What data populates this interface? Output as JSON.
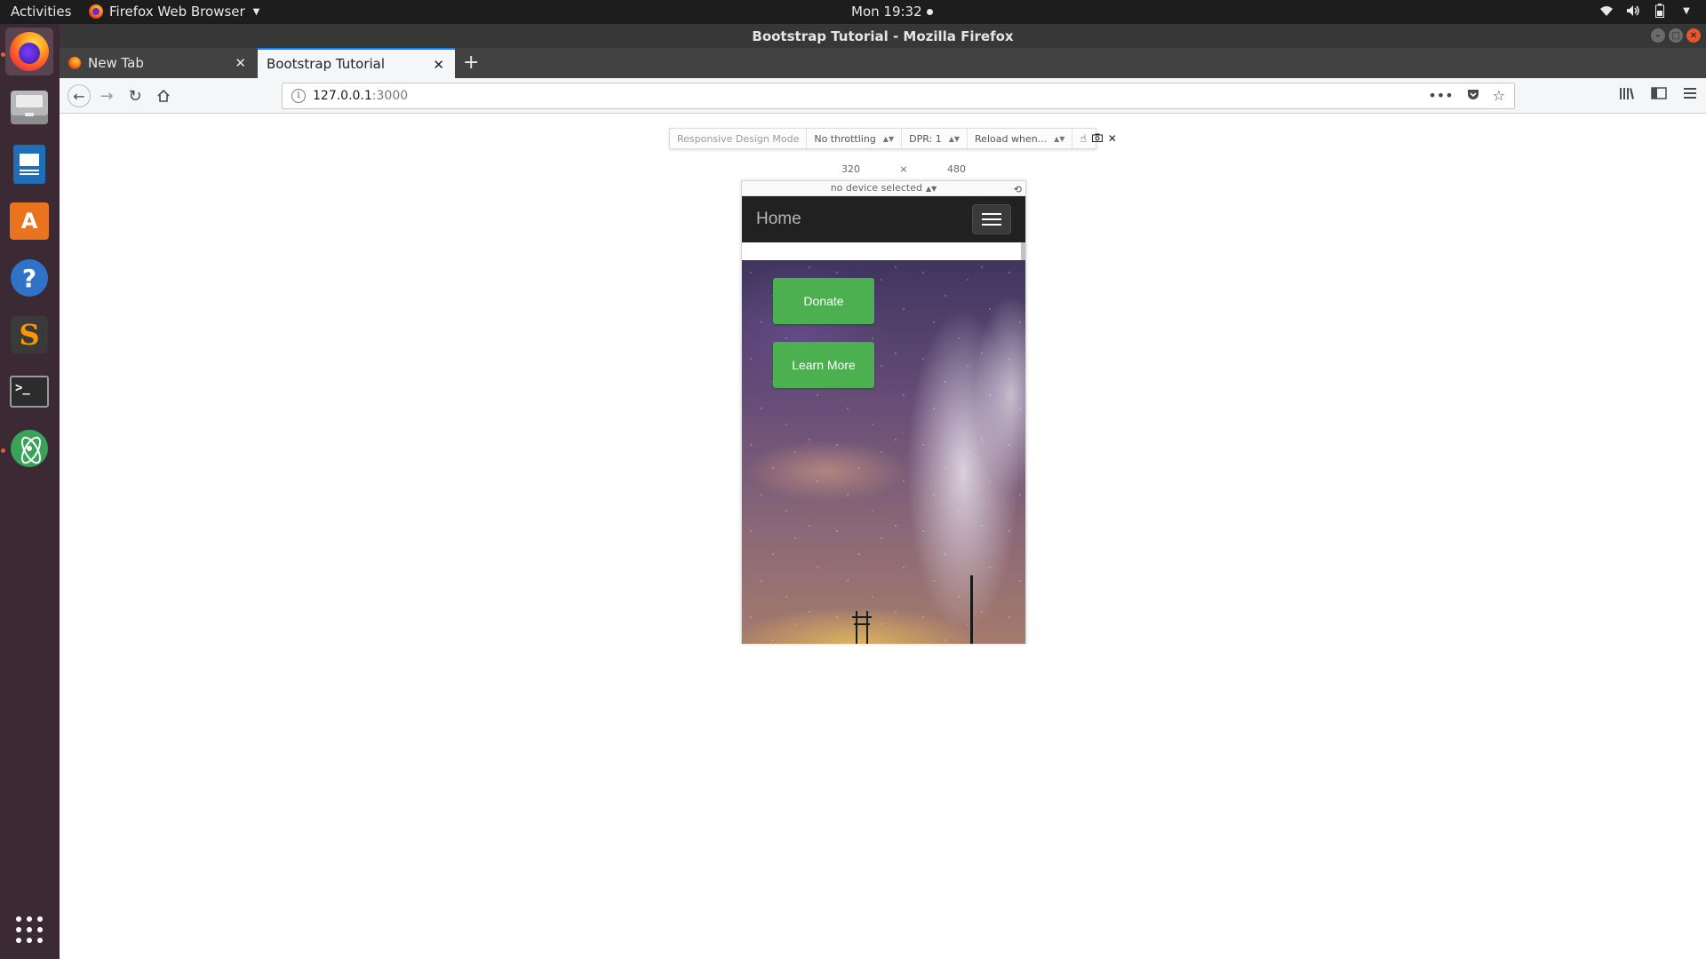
{
  "topbar": {
    "activities": "Activities",
    "app_name": "Firefox Web Browser",
    "clock": "Mon 19:32"
  },
  "window": {
    "title": "Bootstrap Tutorial - Mozilla Firefox"
  },
  "tabs": [
    {
      "label": "New Tab"
    },
    {
      "label": "Bootstrap Tutorial",
      "active": true
    }
  ],
  "url": {
    "host": "127.0.0.1",
    "port": ":3000"
  },
  "rdm": {
    "title": "Responsive Design Mode",
    "throttling": "No throttling",
    "dpr": "DPR: 1",
    "reload": "Reload when...",
    "width": "320",
    "times": "×",
    "height": "480",
    "device": "no device selected"
  },
  "site": {
    "brand": "Home",
    "donate_label": "Donate",
    "learn_more_label": "Learn More",
    "button_color": "#4caf50",
    "navbar_color": "#212121"
  },
  "icons": {
    "dock": [
      "firefox-icon",
      "files-icon",
      "writer-icon",
      "software-store-icon",
      "help-icon",
      "sublime-text-icon",
      "terminal-icon",
      "atom-icon",
      "app-grid-icon"
    ]
  }
}
